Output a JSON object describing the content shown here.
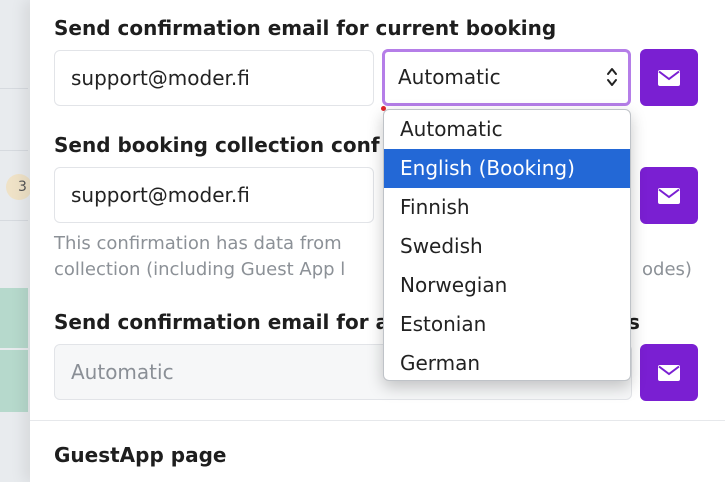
{
  "form": {
    "current_booking": {
      "label": "Send confirmation email for current booking",
      "email": "support@moder.fi",
      "language_value": "Automatic"
    },
    "collection": {
      "label": "Send booking collection conf",
      "email": "support@moder.fi",
      "helper_line1": "This confirmation has data from",
      "helper_line1_tail": "",
      "helper_line2": "collection (including Guest App l",
      "helper_line2_tail": "odes)"
    },
    "all_bookings": {
      "label": "Send confirmation email for a",
      "label_tail": "s",
      "value": "Automatic"
    },
    "guestapp_heading": "GuestApp page"
  },
  "language_dropdown": {
    "options": [
      "Automatic",
      "English (Booking)",
      "Finnish",
      "Swedish",
      "Norwegian",
      "Estonian",
      "German"
    ],
    "selected_index": 1
  },
  "background": {
    "badge_text": "3"
  },
  "colors": {
    "accent": "#7a1fd2",
    "focus_ring": "#b57ee8",
    "selected_option": "#2368d6"
  },
  "icons": {
    "send": "envelope-icon",
    "select_arrows": "up-down-chevron-icon"
  }
}
